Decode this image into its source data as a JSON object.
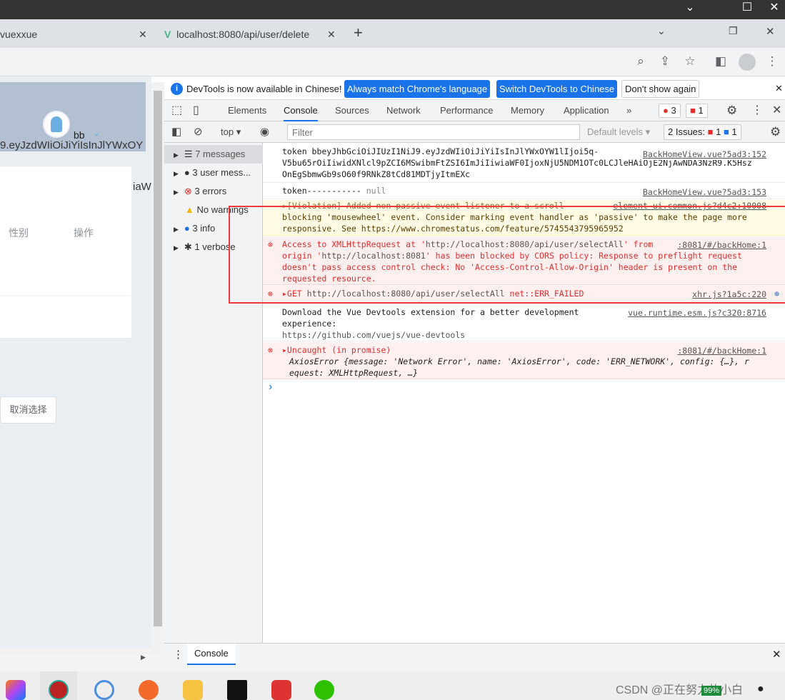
{
  "window": {
    "controls": [
      "chevron-down",
      "maximize",
      "close"
    ]
  },
  "tabs": [
    {
      "title": "vuexxue"
    },
    {
      "title": "localhost:8080/api/user/delete"
    }
  ],
  "page": {
    "username": "bb",
    "token_fragment": "9.eyJzdWIiOiJiYiIsInJlYWxOY",
    "col_gender": "性别",
    "col_action": "操作",
    "edge_text": "iaW",
    "cancel_button": "取消选择"
  },
  "devtools": {
    "infobar": {
      "text": "DevTools is now available in Chinese!",
      "btn_match": "Always match Chrome's language",
      "btn_switch": "Switch DevTools to Chinese",
      "btn_dismiss": "Don't show again"
    },
    "tabs": [
      "Elements",
      "Console",
      "Sources",
      "Network",
      "Performance",
      "Memory",
      "Application"
    ],
    "active_tab": "Console",
    "error_count": "3",
    "warning_count": "1",
    "context": "top",
    "filter_placeholder": "Filter",
    "levels": "Default levels",
    "issues_label": "2 Issues:",
    "issues_err": "1",
    "issues_info": "1",
    "sidebar": [
      {
        "label": "7 messages",
        "icon": "list"
      },
      {
        "label": "3 user mess...",
        "icon": "user"
      },
      {
        "label": "3 errors",
        "icon": "error"
      },
      {
        "label": "No warnings",
        "icon": "warning"
      },
      {
        "label": "3 info",
        "icon": "info"
      },
      {
        "label": "1 verbose",
        "icon": "bug"
      }
    ],
    "messages": [
      {
        "type": "log",
        "lines": [
          "token bbeyJhbGciOiJIUzI1NiJ9.eyJzdWIiOiJiYiIsInJlYWxOYW1lIjoi5q-",
          "V5bu65rOiIiwidXNlcl9pZCI6MSwibmFtZSI6ImJiIiwiaWF0IjoxNjU5NDM1OTc0LCJleHAiOjE2NjAwNDA3NzR9.K5Hsz",
          "OnEgSbmwGb9sO60f9RNkZ8tCd81MDTjyItmEXc"
        ],
        "source": "BackHomeView.vue?5ad3:152"
      },
      {
        "type": "log",
        "text": "token-----------",
        "value": "null",
        "source": "BackHomeView.vue?5ad3:153"
      },
      {
        "type": "warn",
        "lines": [
          "▸[Violation] Added non-passive event listener to a scroll",
          "blocking 'mousewheel' event. Consider marking event handler as 'passive' to make the page more",
          "responsive. See "
        ],
        "link": "https://www.chromestatus.com/feature/5745543795965952",
        "source": "element-ui.common.js?d4c2:10008"
      },
      {
        "type": "error",
        "l1a": "Access to XMLHttpRequest at '",
        "url1": "http://localhost:8080/api/user/selectAll",
        "l1b": "' from",
        "l2a": "origin '",
        "url2": "http://localhost:8081",
        "l2b": "' has been blocked by CORS policy: Response to preflight request",
        "l3": "doesn't pass access control check: No 'Access-Control-Allow-Origin' header is present on the",
        "l4": "requested resource.",
        "source": ":8081/#/backHome:1"
      },
      {
        "type": "error",
        "method": "▸GET",
        "url": "http://localhost:8080/api/user/selectAll",
        "status": "net::ERR_FAILED",
        "source": "xhr.js?1a5c:220"
      },
      {
        "type": "log",
        "lines": [
          "Download the Vue Devtools extension for a better development",
          "experience:"
        ],
        "link": "https://github.com/vuejs/vue-devtools",
        "source": "vue.runtime.esm.js?c320:8716"
      },
      {
        "type": "error",
        "head": "▸Uncaught (in promise)",
        "obj1": "AxiosError {message: 'Network Error', name: 'AxiosError', code: 'ERR_NETWORK', config: {…}, r",
        "obj2": "equest: XMLHttpRequest, …}",
        "source": ":8081/#/backHome:1"
      }
    ],
    "prompt": "›",
    "drawer_tab": "Console"
  },
  "taskbar": {
    "watermark": "CSDN @正在努力的小白",
    "battery": "99%"
  },
  "colors": {
    "accent": "#1a73e8",
    "error": "#e42c2c",
    "highlight_box": "#f03a3a"
  }
}
